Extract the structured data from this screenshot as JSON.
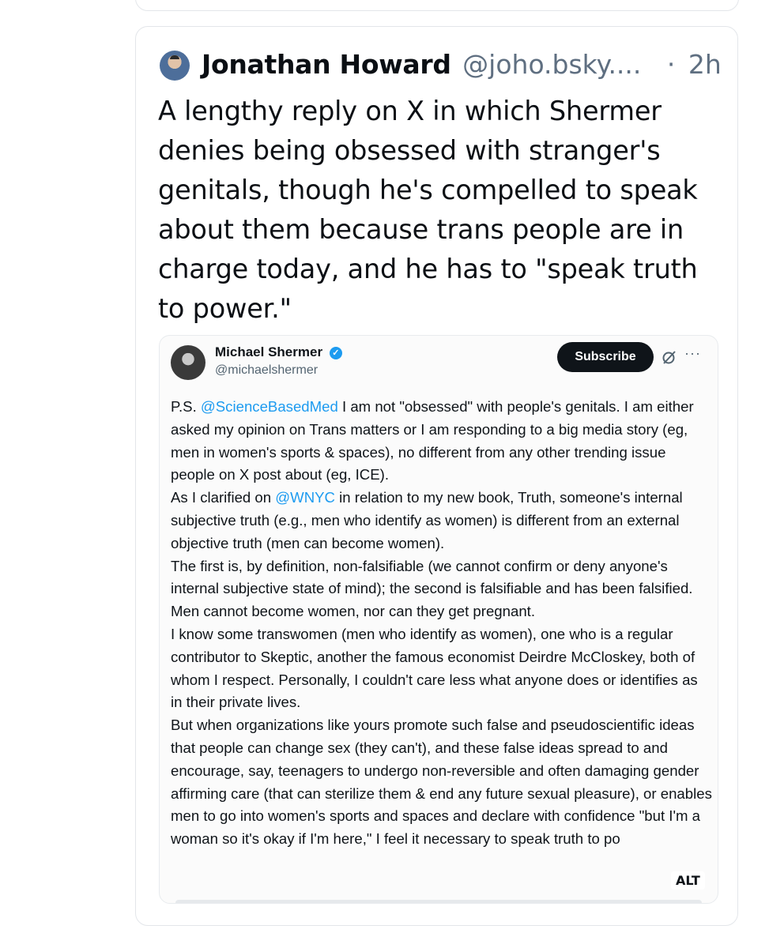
{
  "post": {
    "author": "Jonathan Howard",
    "handle": "@joho.bsky....",
    "separator": "·",
    "time": "2h",
    "text": "A lengthy reply on X in which Shermer denies being obsessed with stranger's genitals, though he's compelled to speak about them because trans people are in charge today, and he has to \"speak truth to power.\""
  },
  "embed": {
    "name": "Michael Shermer",
    "handle": "@michaelshermer",
    "subscribe_label": "Subscribe",
    "more_icon_label": "···",
    "icons": [
      "avatar",
      "verified-badge-icon",
      "grok-icon",
      "more-icon"
    ],
    "accent_color": "#1d9bf0",
    "p1": {
      "a": "P.S. ",
      "mention": "@ScienceBasedMed",
      "b": " I am not \"obsessed\" with people's genitals. I am either asked my opinion on Trans matters or I am responding to a big media story (eg, men in women's sports & spaces), no different from any other trending issue people on X post about (eg, ICE)."
    },
    "p2": {
      "a": "As I clarified on ",
      "mention": "@WNYC",
      "b": " in relation to my new book, Truth, someone's internal subjective truth (e.g., men who identify as women) is different from an external objective truth (men can become women)."
    },
    "p3": "The first is, by definition, non-falsifiable (we cannot confirm or deny anyone's internal subjective state of mind); the second is falsifiable and has been falsified. Men cannot become women, nor can they get pregnant.",
    "p4": "I know some transwomen (men who identify as women), one who is a regular contributor to Skeptic, another the famous economist Deirdre McCloskey, both of whom I respect. Personally, I couldn't care less what anyone does or identifies as in their private lives.",
    "p5": "But when organizations like yours promote such false and pseudoscientific ideas that people can change sex (they can't), and these false ideas spread to and encourage, say, teenagers to undergo non-reversible and often damaging gender affirming care (that can sterilize them & end any future sexual pleasure), or enables men to go into women's sports and spaces and declare with confidence \"but I'm a woman so it's okay if I'm here,\" I feel it necessary to speak truth to po",
    "alt_label": "ALT"
  }
}
